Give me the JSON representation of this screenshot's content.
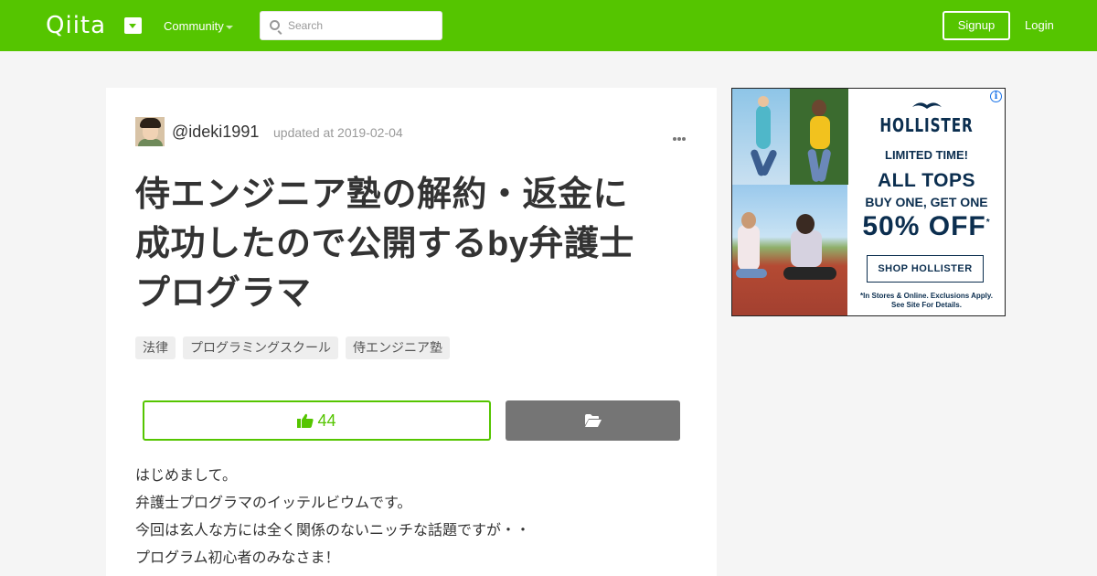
{
  "header": {
    "logo": "Qiita",
    "community_label": "Community",
    "search_placeholder": "Search",
    "signup_label": "Signup",
    "login_label": "Login"
  },
  "article": {
    "author": "@ideki1991",
    "updated": "updated at 2019-02-04",
    "title_lines": [
      "侍エンジニア塾の解約・返金に",
      "成功したので公開するby弁護士",
      "プログラマ"
    ],
    "tags": [
      "法律",
      "プログラミングスクール",
      "侍エンジニア塾"
    ],
    "like_count": "44",
    "body_lines": [
      "はじめまして。",
      "弁護士プログラマのイッテルビウムです。",
      "今回は玄人な方には全く関係のないニッチな話題ですが・・",
      "プログラム初心者のみなさま！"
    ]
  },
  "ad": {
    "info_icon": "i",
    "brand": "HOLLISTER",
    "line1": "LIMITED TIME!",
    "line2": "ALL TOPS",
    "line3": "BUY ONE, GET ONE",
    "line4": "50% OFF",
    "line4_mark": "*",
    "button": "SHOP HOLLISTER",
    "fine1": "*In Stores & Online. Exclusions Apply.",
    "fine2": "See Site For Details."
  },
  "colors": {
    "brand_green": "#55c500",
    "ad_navy": "#0b2e4f",
    "stock_gray": "#757575"
  }
}
